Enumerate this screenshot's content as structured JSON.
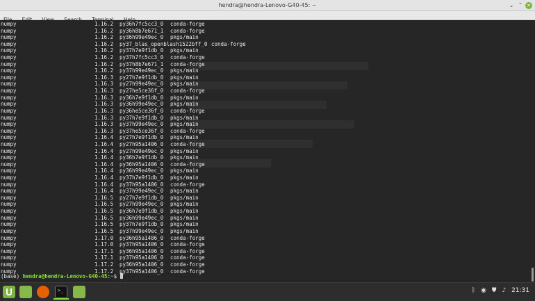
{
  "window": {
    "title": "hendra@hendra-Lenovo-G40-45: ~",
    "minimize_glyph": "⌄",
    "maximize_glyph": "⌃",
    "close_glyph": "✕"
  },
  "menu": [
    "File",
    "Edit",
    "View",
    "Search",
    "Terminal",
    "Help"
  ],
  "terminal": {
    "rows": [
      [
        "numpy",
        "1.16.2",
        "py36h7fc5cc3_0",
        "conda-forge"
      ],
      [
        "numpy",
        "1.16.2",
        "py36h8b7e671_1",
        "conda-forge"
      ],
      [
        "numpy",
        "1.16.2",
        "py36h99e49ec_0",
        "pkgs/main"
      ],
      [
        "numpy",
        "1.16.2",
        "py37_blas_openblash1522bff_0",
        "conda-forge"
      ],
      [
        "numpy",
        "1.16.2",
        "py37h7e9f1db_0",
        "pkgs/main"
      ],
      [
        "numpy",
        "1.16.2",
        "py37h7fc5cc3_0",
        "conda-forge"
      ],
      [
        "numpy",
        "1.16.2",
        "py37h8b7e671_1",
        "conda-forge"
      ],
      [
        "numpy",
        "1.16.2",
        "py37h99e49ec_0",
        "pkgs/main"
      ],
      [
        "numpy",
        "1.16.3",
        "py27h7e9f1db_0",
        "pkgs/main"
      ],
      [
        "numpy",
        "1.16.3",
        "py27h99e49ec_0",
        "pkgs/main"
      ],
      [
        "numpy",
        "1.16.3",
        "py27he5ce36f_0",
        "conda-forge"
      ],
      [
        "numpy",
        "1.16.3",
        "py36h7e9f1db_0",
        "pkgs/main"
      ],
      [
        "numpy",
        "1.16.3",
        "py36h99e49ec_0",
        "pkgs/main"
      ],
      [
        "numpy",
        "1.16.3",
        "py36he5ce36f_0",
        "conda-forge"
      ],
      [
        "numpy",
        "1.16.3",
        "py37h7e9f1db_0",
        "pkgs/main"
      ],
      [
        "numpy",
        "1.16.3",
        "py37h99e49ec_0",
        "pkgs/main"
      ],
      [
        "numpy",
        "1.16.3",
        "py37he5ce36f_0",
        "conda-forge"
      ],
      [
        "numpy",
        "1.16.4",
        "py27h7e9f1db_0",
        "pkgs/main"
      ],
      [
        "numpy",
        "1.16.4",
        "py27h95a1406_0",
        "conda-forge"
      ],
      [
        "numpy",
        "1.16.4",
        "py27h99e49ec_0",
        "pkgs/main"
      ],
      [
        "numpy",
        "1.16.4",
        "py36h7e9f1db_0",
        "pkgs/main"
      ],
      [
        "numpy",
        "1.16.4",
        "py36h95a1406_0",
        "conda-forge"
      ],
      [
        "numpy",
        "1.16.4",
        "py36h99e49ec_0",
        "pkgs/main"
      ],
      [
        "numpy",
        "1.16.4",
        "py37h7e9f1db_0",
        "pkgs/main"
      ],
      [
        "numpy",
        "1.16.4",
        "py37h95a1406_0",
        "conda-forge"
      ],
      [
        "numpy",
        "1.16.4",
        "py37h99e49ec_0",
        "pkgs/main"
      ],
      [
        "numpy",
        "1.16.5",
        "py27h7e9f1db_0",
        "pkgs/main"
      ],
      [
        "numpy",
        "1.16.5",
        "py27h99e49ec_0",
        "pkgs/main"
      ],
      [
        "numpy",
        "1.16.5",
        "py36h7e9f1db_0",
        "pkgs/main"
      ],
      [
        "numpy",
        "1.16.5",
        "py36h99e49ec_0",
        "pkgs/main"
      ],
      [
        "numpy",
        "1.16.5",
        "py37h7e9f1db_0",
        "pkgs/main"
      ],
      [
        "numpy",
        "1.16.5",
        "py37h99e49ec_0",
        "pkgs/main"
      ],
      [
        "numpy",
        "1.17.0",
        "py36h95a1406_0",
        "conda-forge"
      ],
      [
        "numpy",
        "1.17.0",
        "py37h95a1406_0",
        "conda-forge"
      ],
      [
        "numpy",
        "1.17.1",
        "py36h95a1406_0",
        "conda-forge"
      ],
      [
        "numpy",
        "1.17.1",
        "py37h95a1406_0",
        "conda-forge"
      ],
      [
        "numpy",
        "1.17.2",
        "py36h95a1406_0",
        "conda-forge"
      ],
      [
        "numpy",
        "1.17.2",
        "py37h95a1406_0",
        "conda-forge"
      ]
    ],
    "prompt": {
      "env": "(base) ",
      "user_host": "hendra@hendra-Lenovo-G40-45",
      "sep": ":",
      "path": "~",
      "symbol": "$ "
    }
  },
  "taskbar": {
    "icons": [
      "menu-icon",
      "files-icon",
      "firefox-icon",
      "terminal-icon",
      "folder-icon"
    ],
    "tray": {
      "bluetooth": "ᛒ",
      "network": "◉",
      "shield": "⛊",
      "volume": "♪",
      "clock": "21:31"
    }
  }
}
